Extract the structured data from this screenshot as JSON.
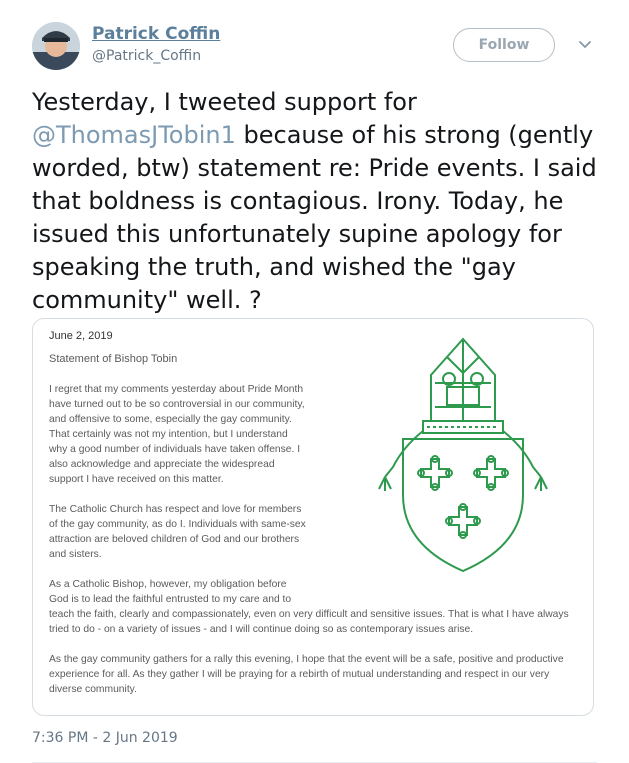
{
  "user": {
    "display_name": "Patrick Coffin",
    "handle": "@Patrick_Coffin"
  },
  "follow_label": "Follow",
  "tweet": {
    "text_pre": "Yesterday, I tweeted support for ",
    "mention": "@ThomasJTobin1",
    "text_post": " because of his strong (gently worded, btw) statement re: Pride events. I said that boldness is contagious. Irony. Today, he issued this unfortunately supine apology for speaking the truth, and wished the \"gay community\" well. ?"
  },
  "statement": {
    "date": "June 2, 2019",
    "title": "Statement of Bishop Tobin",
    "p1": "I regret that my comments yesterday about Pride Month have turned out to be so controversial in our community, and offensive to some, especially the gay community. That certainly was not my intention, but I understand why a good number of individuals have taken offense. I also acknowledge and appreciate the widespread support I have received on this matter.",
    "p2": "The Catholic Church has respect and love for members of the gay community, as do I. Individuals with same-sex attraction are beloved children of God and our brothers and sisters.",
    "p3a": "As a Catholic Bishop, however, my obligation before God is to lead the faithful entrusted to my care and to",
    "p3b": "teach the faith, clearly and compassionately, even on very difficult and sensitive issues.  That is what I have always tried to do - on a variety of issues - and I will continue doing so as contemporary issues arise.",
    "p4": "As the gay community gathers for a rally this evening, I hope that the event will be a safe, positive and productive experience for all. As they gather I will be praying for a rebirth of mutual understanding and respect in our very diverse community."
  },
  "timestamp": "7:36 PM - 2 Jun 2019",
  "icons": {
    "chevron": "chevron-down-icon",
    "crest": "crest-icon"
  },
  "colors": {
    "crest_green": "#2e9a4e",
    "name_link": "#5c7f9b",
    "mention": "#7d9ab3"
  }
}
